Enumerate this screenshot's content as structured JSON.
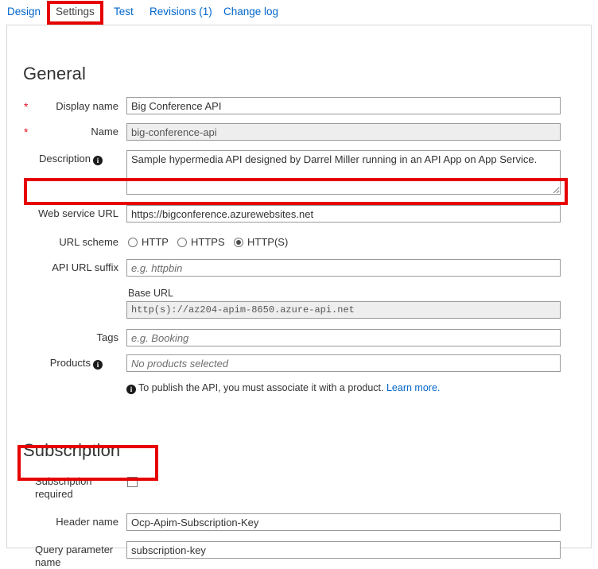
{
  "tabs": [
    {
      "label": "Design",
      "active": false
    },
    {
      "label": "Settings",
      "active": true
    },
    {
      "label": "Test",
      "active": false
    },
    {
      "label": "Revisions (1)",
      "active": false
    },
    {
      "label": "Change log",
      "active": false
    }
  ],
  "general": {
    "title": "General",
    "display_name": {
      "label": "Display name",
      "required_marker": "*",
      "value": "Big Conference API"
    },
    "name": {
      "label": "Name",
      "required_marker": "*",
      "value": "big-conference-api"
    },
    "description": {
      "label": "Description",
      "info_glyph": "i",
      "value": "Sample hypermedia API designed by Darrel Miller running in an API App on App Service."
    },
    "web_service_url": {
      "label": "Web service URL",
      "value": "https://bigconference.azurewebsites.net"
    },
    "url_scheme": {
      "label": "URL scheme",
      "options": [
        {
          "label": "HTTP",
          "selected": false
        },
        {
          "label": "HTTPS",
          "selected": false
        },
        {
          "label": "HTTP(S)",
          "selected": true
        }
      ]
    },
    "api_url_suffix": {
      "label": "API URL suffix",
      "value": "",
      "placeholder": "e.g. httpbin"
    },
    "base_url": {
      "label": "Base URL",
      "value": "http(s)://az204-apim-8650.azure-api.net"
    },
    "tags": {
      "label": "Tags",
      "value": "",
      "placeholder": "e.g. Booking"
    },
    "products": {
      "label": "Products",
      "info_glyph": "i",
      "value": "",
      "placeholder": "No products selected"
    },
    "note": {
      "info_glyph": "i",
      "text": "To publish the API, you must associate it with a product.",
      "link_text": "Learn more.",
      "link_color": "#0066cc"
    }
  },
  "subscription": {
    "title": "Subscription",
    "required": {
      "label_line1": "Subscription",
      "label_line2": "required",
      "checked": false
    },
    "header_name": {
      "label": "Header name",
      "value": "Ocp-Apim-Subscription-Key"
    },
    "query_parameter_name": {
      "label_line1": "Query parameter",
      "label_line2": "name",
      "value": "subscription-key"
    }
  },
  "annotations": {
    "highlight_color": "#e60000",
    "boxes": [
      "settings-tab",
      "web-service-url",
      "subscription-required"
    ]
  }
}
